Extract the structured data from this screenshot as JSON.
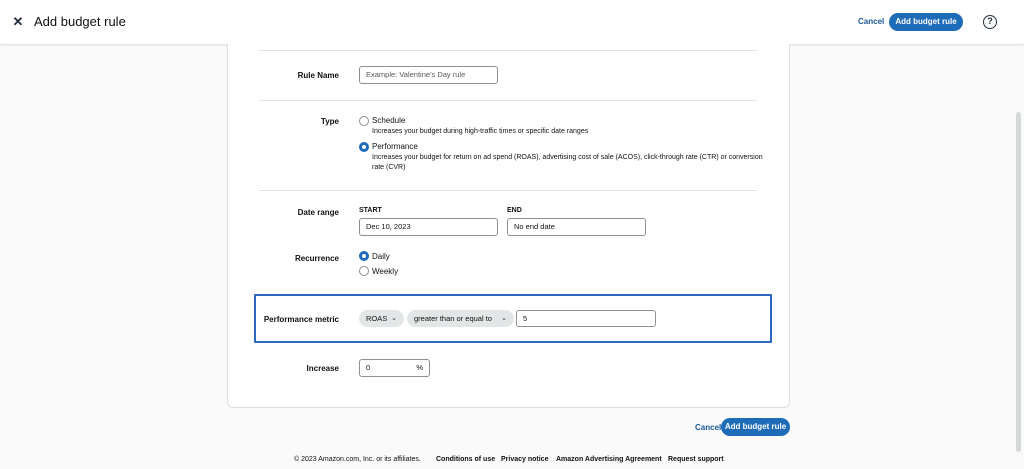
{
  "header": {
    "title": "Add budget rule",
    "cancel_label": "Cancel",
    "add_label": "Add budget rule",
    "close_glyph": "✕",
    "help_glyph": "?"
  },
  "form": {
    "rule_name": {
      "label": "Rule Name",
      "placeholder": "Example: Valentine's Day rule"
    },
    "type": {
      "label": "Type",
      "options": [
        {
          "label": "Schedule",
          "description": "Increases your budget during high-traffic times or specific date ranges",
          "checked": false
        },
        {
          "label": "Performance",
          "description": "Increases your budget for return on ad spend (ROAS), advertising cost of sale (ACOS), click-through rate (CTR) or conversion rate (CVR)",
          "checked": true
        }
      ]
    },
    "date_range": {
      "label": "Date range",
      "start_label": "START",
      "start_value": "Dec 10, 2023",
      "end_label": "END",
      "end_value": "No end date"
    },
    "recurrence": {
      "label": "Recurrence",
      "options": [
        {
          "label": "Daily",
          "checked": true
        },
        {
          "label": "Weekly",
          "checked": false
        }
      ]
    },
    "performance_metric": {
      "label": "Performance metric",
      "metric": "ROAS",
      "operator": "greater than or equal to",
      "value": "5"
    },
    "increase": {
      "label": "Increase",
      "value": "0",
      "unit": "%"
    }
  },
  "bottom_actions": {
    "cancel_label": "Cancel",
    "add_label": "Add budget rule"
  },
  "footer": {
    "copyright": "© 2023 Amazon.com, Inc. or its affiliates.",
    "links": [
      "Conditions of use",
      "Privacy notice",
      "Amazon Advertising Agreement",
      "Request support"
    ]
  },
  "colors": {
    "primary_button": "#1e6bb8",
    "link": "#1a5a96",
    "highlight_border": "#2b66c1"
  },
  "icons": {
    "close": "close-icon",
    "help": "help-icon",
    "dropdown": "chevron-down-icon"
  }
}
